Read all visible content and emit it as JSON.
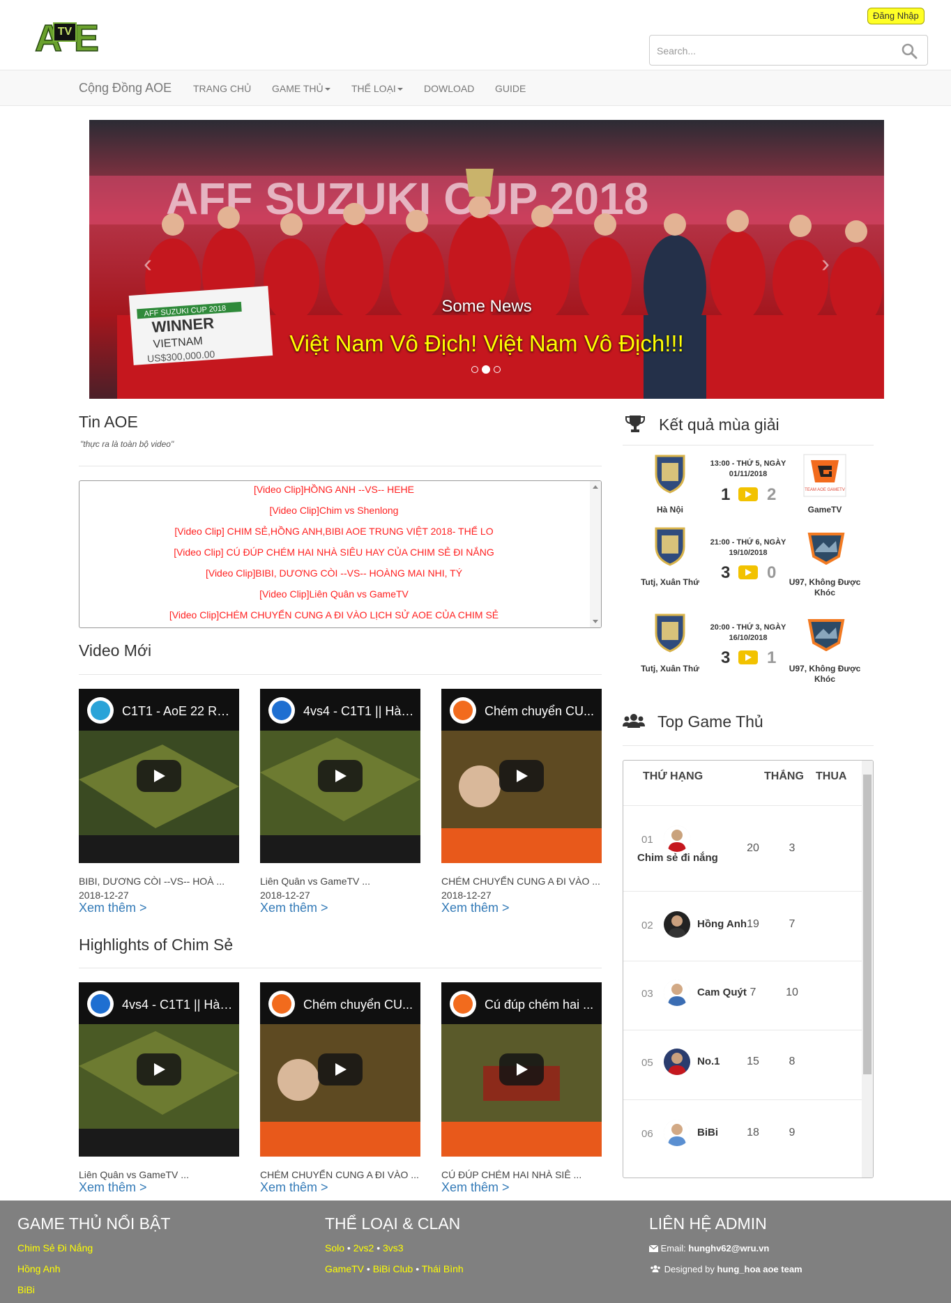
{
  "header": {
    "logo_text_left": "A",
    "logo_text_tv": "TV",
    "logo_text_right": "E",
    "login_label": "Đăng Nhập",
    "search_placeholder": "Search..."
  },
  "navbar": {
    "brand": "Cộng Đồng AOE",
    "items": [
      {
        "label": "TRANG CHỦ",
        "dropdown": false
      },
      {
        "label": "GAME THỦ",
        "dropdown": true
      },
      {
        "label": "THỂ LOẠI",
        "dropdown": true
      },
      {
        "label": "DOWLOAD",
        "dropdown": false
      },
      {
        "label": "GUIDE",
        "dropdown": false
      }
    ]
  },
  "carousel": {
    "caption_title": "Some News",
    "caption_text": "Việt Nam Vô Địch! Việt Nam Vô Địch!!!",
    "banner_text": "AFF SUZUKI CUP 2018",
    "sign_line1": "AFF SUZUKI CUP 2018",
    "sign_line2": "WINNER",
    "sign_line3": "VIETNAM",
    "sign_line4": "US$300,000.00",
    "active_slide": 2,
    "slides": 3
  },
  "news": {
    "title": "Tin AOE",
    "subtitle": "\"thực ra là toàn bộ video\"",
    "items": [
      "[Video Clip]HỒNG ANH --VS-- HEHE",
      "[Video Clip]Chim vs Shenlong",
      "[Video Clip] CHIM SẺ,HỒNG ANH,BIBI AOE TRUNG VIỆT 2018- THỂ LO",
      "[Video Clip] CÚ ĐÚP CHÉM HAI NHÀ SIÊU HAY CỦA CHIM SẺ ĐI NẮNG",
      "[Video Clip]BIBI, DƯƠNG CÒI --VS-- HOÀNG MAI NHI, TÝ",
      "[Video Clip]Liên Quân vs GameTV",
      "[Video Clip]CHÉM CHUYỂN CUNG A ĐI VÀO LỊCH SỬ AOE CỦA CHIM SẺ"
    ]
  },
  "videos_new": {
    "title": "Video Mới",
    "items": [
      {
        "thumb_title": "C1T1 - AoE 22 Ra...",
        "caption": "BIBI, DƯƠNG CÒI --VS-- HOÀ ...",
        "date": "2018-12-27",
        "more": "Xem thêm >",
        "channel_color": "#29a3d8",
        "bg": "#3a4a22"
      },
      {
        "thumb_title": "4vs4 - C1T1 || Hà ...",
        "caption": "Liên Quân vs GameTV ...",
        "date": "2018-12-27",
        "more": "Xem thêm >",
        "channel_color": "#1e6fd1",
        "bg": "#4a5a25"
      },
      {
        "thumb_title": "Chém chuyển CU...",
        "caption": "CHÉM CHUYỂN CUNG A ĐI VÀO ...",
        "date": "2018-12-27",
        "more": "Xem thêm >",
        "channel_color": "#f26b1d",
        "bg": "#5e4a22"
      }
    ]
  },
  "videos_highlights": {
    "title": "Highlights of Chim Sẻ",
    "items": [
      {
        "thumb_title": "4vs4 - C1T1 || Hà ...",
        "caption": "Liên Quân vs GameTV ...",
        "more": "Xem thêm >",
        "channel_color": "#1e6fd1",
        "bg": "#4a5a25"
      },
      {
        "thumb_title": "Chém chuyển CU...",
        "caption": "CHÉM CHUYỂN CUNG A ĐI VÀO ...",
        "more": "Xem thêm >",
        "channel_color": "#f26b1d",
        "bg": "#5e4a22"
      },
      {
        "thumb_title": "Cú đúp chém hai ...",
        "caption": "CÚ ĐÚP CHÉM HAI NHÀ SIÊ ...",
        "more": "Xem thêm >",
        "channel_color": "#f26b1d",
        "bg": "#5a5a2a"
      }
    ]
  },
  "results": {
    "title": "Kết quả mùa giải",
    "matches": [
      {
        "home": "Hà Nội",
        "away": "GameTV",
        "time_line1": "13:00 - THỨ 5, NGÀY",
        "time_line2": "01/11/2018",
        "home_score": "1",
        "away_score": "2",
        "away_logo": "gametv"
      },
      {
        "home": "Tutj, Xuân Thứ",
        "away": "U97, Không Được Khóc",
        "time_line1": "21:00 - THỨ 6, NGÀY",
        "time_line2": "19/10/2018",
        "home_score": "3",
        "away_score": "0",
        "away_logo": "u97"
      },
      {
        "home": "Tutj, Xuân Thứ",
        "away": "U97, Không Được Khóc",
        "time_line1": "20:00 - THỨ 3, NGÀY",
        "time_line2": "16/10/2018",
        "home_score": "3",
        "away_score": "1",
        "away_logo": "u97"
      }
    ],
    "away_badge_text": "TEAM AOE GAMETV"
  },
  "top_players": {
    "title": "Top Game Thủ",
    "col_rank": "THỨ HẠNG",
    "col_win": "THẮNG",
    "col_loss": "THUA",
    "rows": [
      {
        "rank": "01",
        "name": "Chim sẻ đi nắng",
        "wins": "20",
        "losses": "3"
      },
      {
        "rank": "02",
        "name": "Hồng Anh",
        "wins": "19",
        "losses": "7"
      },
      {
        "rank": "03",
        "name": "Cam Quýt",
        "wins": "7",
        "losses": "10"
      },
      {
        "rank": "05",
        "name": "No.1",
        "wins": "15",
        "losses": "8"
      },
      {
        "rank": "06",
        "name": "BiBi",
        "wins": "18",
        "losses": "9"
      }
    ]
  },
  "footer": {
    "col1_title": "GAME THỦ NỔI BẬT",
    "col1_links": [
      "Chim Sẻ Đi Nắng",
      "Hồng Anh",
      "BiBi"
    ],
    "col2_title": "THỂ LOẠI & CLAN",
    "col2_row1": [
      "Solo",
      "2vs2",
      "3vs3"
    ],
    "col2_row2": [
      "GameTV",
      "BiBi Club",
      "Thái Bình"
    ],
    "sep": "•",
    "col3_title": "LIÊN HỆ ADMIN",
    "email_label": "Email:",
    "email": "hunghv62@wru.vn",
    "designed_label": "Designed by",
    "designed_by": "hung_hoa aoe team"
  },
  "colors": {
    "accent_yellow": "#ffff00",
    "link_blue": "#337ab7",
    "news_red": "#ff1f1f",
    "footer_bg": "#808080"
  }
}
